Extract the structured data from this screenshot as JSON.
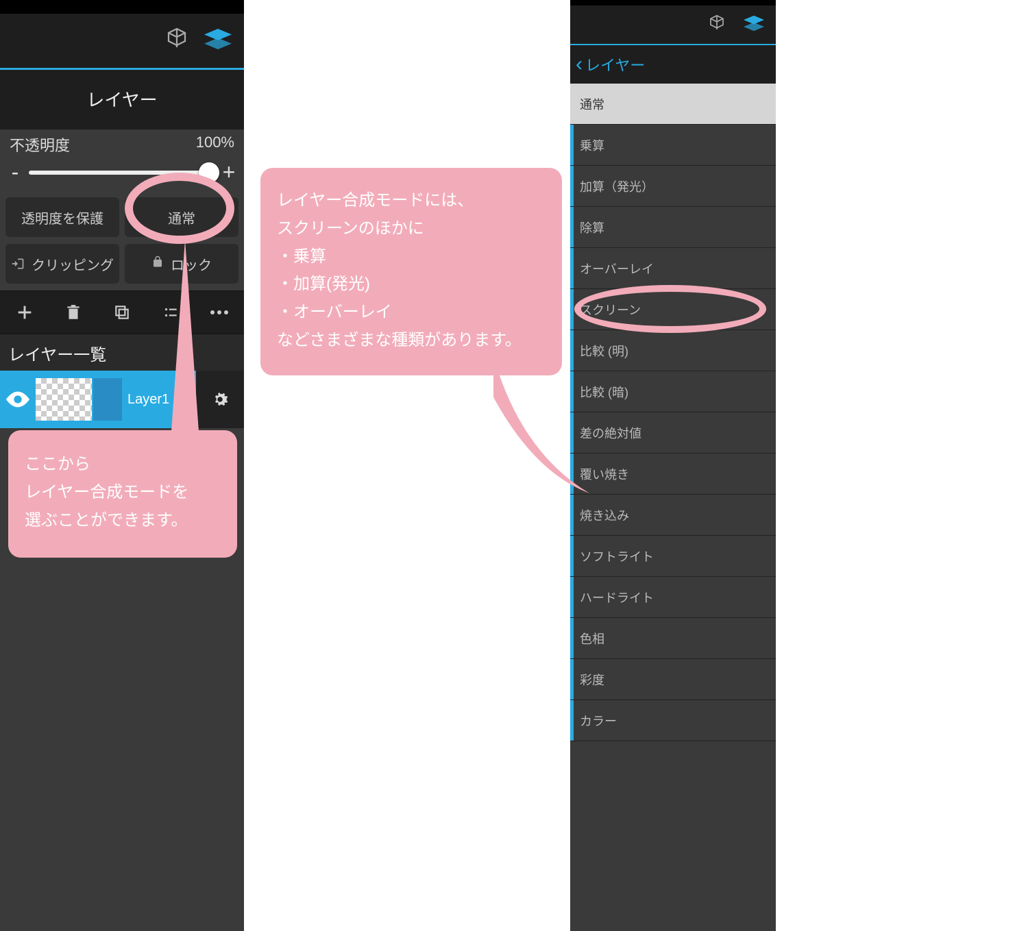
{
  "left": {
    "title": "レイヤー",
    "opacity_label": "不透明度",
    "opacity_value": "100%",
    "minus": "-",
    "plus": "+",
    "protect_btn": "透明度を保護",
    "blend_btn": "通常",
    "clipping_btn": "クリッピング",
    "lock_btn": "ロック",
    "section_label": "レイヤー一覧",
    "layer_name": "Layer1"
  },
  "callout1": {
    "l1": "ここから",
    "l2": "レイヤー合成モードを",
    "l3": "選ぶことができます。"
  },
  "callout2": {
    "l1": "レイヤー合成モードには、",
    "l2": "スクリーンのほかに",
    "l3": "・乗算",
    "l4": "・加算(発光)",
    "l5": "・オーバーレイ",
    "l6": "などさまざまな種類があります。"
  },
  "right": {
    "back_label": "レイヤー",
    "modes": [
      "通常",
      "乗算",
      "加算（発光）",
      "除算",
      "オーバーレイ",
      "スクリーン",
      "比較 (明)",
      "比較 (暗)",
      "差の絶対値",
      "覆い焼き",
      "焼き込み",
      "ソフトライト",
      "ハードライト",
      "色相",
      "彩度",
      "カラー"
    ]
  }
}
